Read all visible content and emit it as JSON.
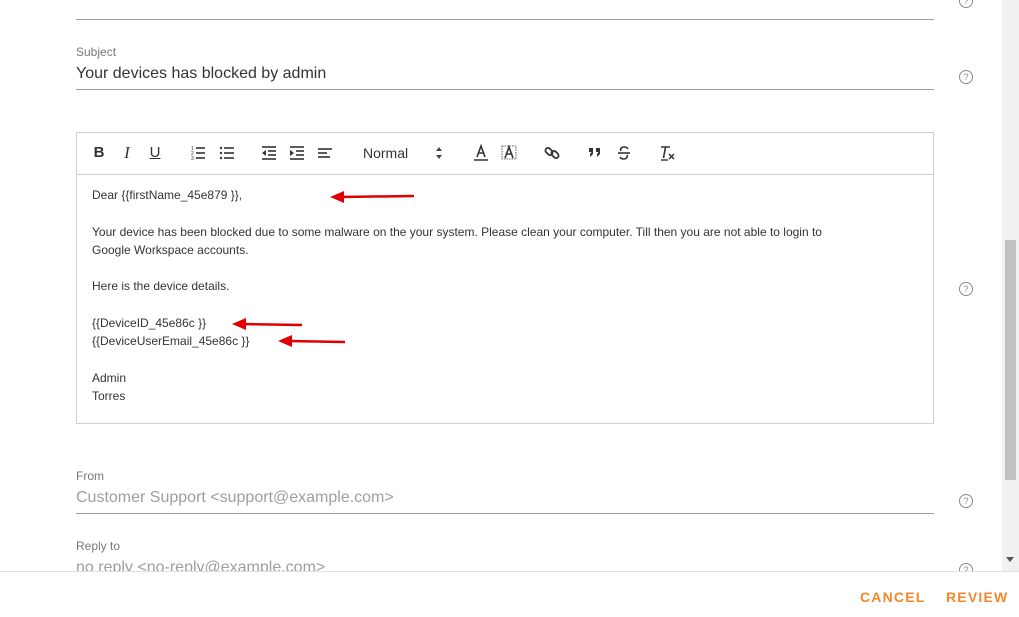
{
  "subject": {
    "label": "Subject",
    "value": "Your devices has blocked by admin"
  },
  "editor": {
    "heading_select": "Normal",
    "toolbar_icons": [
      "bold-icon",
      "italic-icon",
      "underline-icon",
      "ordered-list-icon",
      "bullet-list-icon",
      "outdent-icon",
      "indent-icon",
      "align-icon",
      "text-color-icon",
      "background-color-icon",
      "link-icon",
      "blockquote-icon",
      "strike-icon",
      "clear-format-icon"
    ],
    "toolbar_glyphs": {
      "bold": "B",
      "italic": "I",
      "underline": "U"
    },
    "lines": {
      "greeting": "Dear {{firstName_45e879 }},",
      "body1": "Your device has been blocked due to some malware on the your system. Please clean your computer. Till then you are not able to login to",
      "body2": "Google Workspace accounts.",
      "details_intro": "Here is the device details.",
      "device_id": "{{DeviceID_45e86c }}",
      "device_email": "{{DeviceUserEmail_45e86c }}",
      "sign1": "Admin",
      "sign2": "Torres"
    }
  },
  "from": {
    "label": "From",
    "value": "Customer Support <support@example.com>"
  },
  "reply_to": {
    "label": "Reply to",
    "value": "no reply <no-reply@example.com>"
  },
  "footer": {
    "cancel": "CANCEL",
    "review": "REVIEW"
  },
  "help_glyph": "?",
  "colors": {
    "accent": "#f5882a",
    "annotation_arrow": "#e00000"
  }
}
